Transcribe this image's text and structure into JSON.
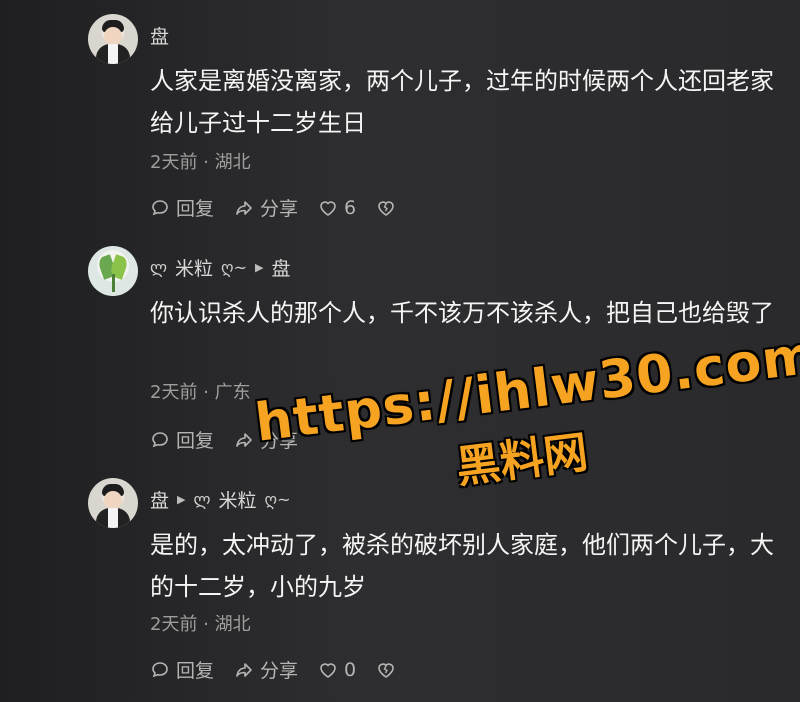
{
  "comments": [
    {
      "name": "盘",
      "text": "人家是离婚没离家，两个儿子，过年的时候两个人还回老家给儿子过十二岁生日",
      "meta": "2天前 · 湖北",
      "reply_label": "回复",
      "share_label": "分享",
      "like_count": "6"
    },
    {
      "name": "米粒",
      "reply_to": "盘",
      "text": "你认识杀人的那个人，千不该万不该杀人，把自己也给毁了",
      "meta": "2天前 · 广东",
      "reply_label": "回复",
      "share_label": "分享"
    },
    {
      "name": "盘",
      "reply_to": "米粒",
      "text": "是的，太冲动了，被杀的破坏别人家庭，他们两个儿子，大的十二岁，小的九岁",
      "meta": "2天前 · 湖北",
      "reply_label": "回复",
      "share_label": "分享",
      "like_count": "0"
    }
  ],
  "watermark": {
    "line1": "https://ihlw30.com",
    "line2": "黑料网"
  },
  "colors": {
    "background": "#2a2a2c",
    "watermark": "#f5a321"
  }
}
